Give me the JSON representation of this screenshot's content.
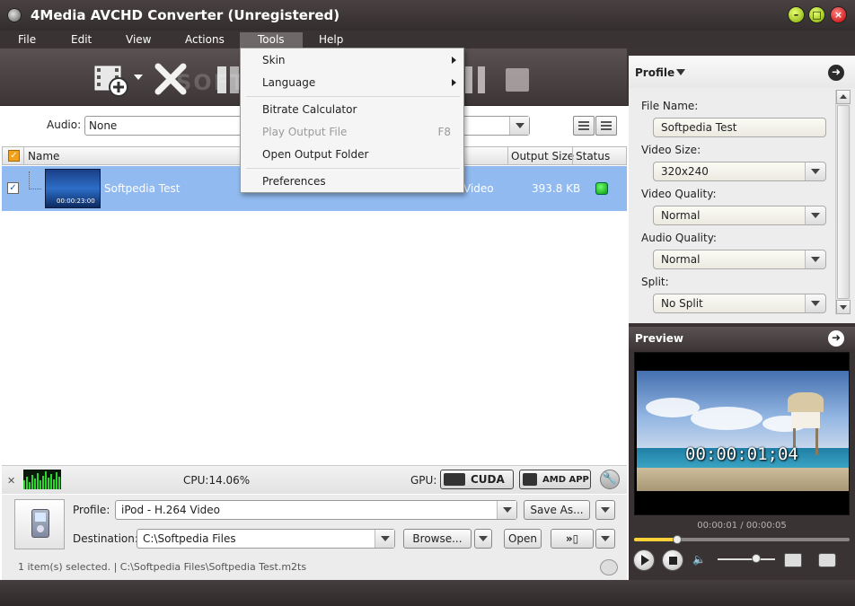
{
  "window": {
    "title": "4Media AVCHD Converter (Unregistered)"
  },
  "menu": {
    "items": [
      "File",
      "Edit",
      "View",
      "Actions",
      "Tools",
      "Help"
    ],
    "active": "Tools"
  },
  "tools_menu": {
    "skin": "Skin",
    "language": "Language",
    "bitrate_calculator": "Bitrate Calculator",
    "play_output_file": "Play Output File",
    "play_output_shortcut": "F8",
    "open_output_folder": "Open Output Folder",
    "preferences": "Preferences"
  },
  "toolbar": {
    "watermark": "SOFTPEDIA"
  },
  "audio": {
    "label": "Audio:",
    "value": "None"
  },
  "table": {
    "headers": {
      "name": "Name",
      "output_size": "Output Size",
      "status": "Status"
    },
    "rows": [
      {
        "name": "Softpedia Test",
        "format": "Video",
        "output_size": "393.8 KB",
        "thumb_time": "00:00:23:00"
      }
    ]
  },
  "cpu": {
    "text": "CPU:14.06%",
    "gpu_label": "GPU:",
    "cuda": "CUDA",
    "amd": "AMD APP"
  },
  "output": {
    "profile_label": "Profile:",
    "profile_value": "iPod - H.264 Video",
    "save_as": "Save As...",
    "destination_label": "Destination:",
    "destination_value": "C:\\Softpedia Files",
    "browse": "Browse...",
    "open": "Open",
    "status": "1 item(s) selected. | C:\\Softpedia Files\\Softpedia Test.m2ts"
  },
  "profile_panel": {
    "title": "Profile",
    "file_name_label": "File Name:",
    "file_name_value": "Softpedia Test",
    "video_size_label": "Video Size:",
    "video_size_value": "320x240",
    "video_quality_label": "Video Quality:",
    "video_quality_value": "Normal",
    "audio_quality_label": "Audio Quality:",
    "audio_quality_value": "Normal",
    "split_label": "Split:",
    "split_value": "No Split"
  },
  "preview": {
    "title": "Preview",
    "timecode": "00:00:01;04",
    "time": "00:00:01 / 00:00:05",
    "progress": 0.2
  },
  "colors": {
    "accent_selection": "#91baf0",
    "status_ok": "#0a9a0a",
    "seek_fill": "#ffd23a"
  }
}
